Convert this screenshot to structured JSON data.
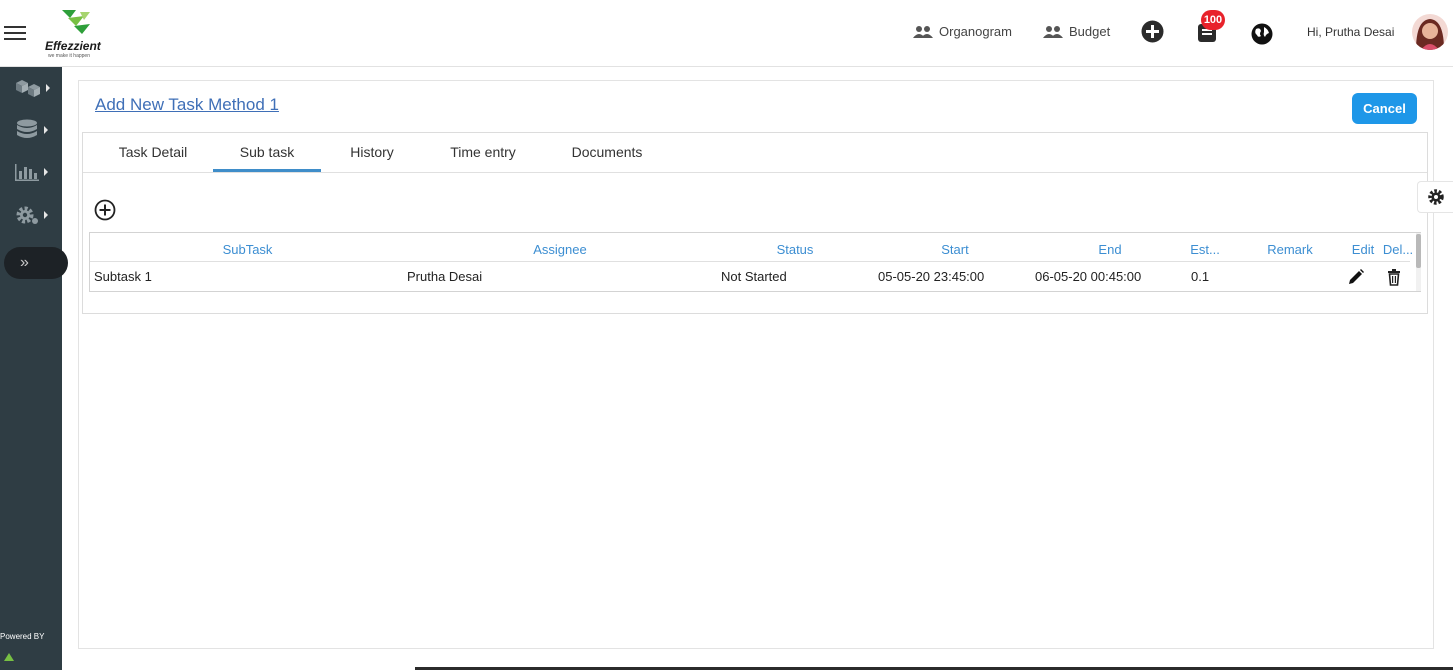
{
  "header": {
    "logo_name": "Effezzient",
    "logo_tagline": "we make it happen",
    "links": [
      {
        "label": "Organogram",
        "icon": "people-icon"
      },
      {
        "label": "Budget",
        "icon": "people-icon"
      }
    ],
    "notification_count": "100",
    "greeting": "Hi, Prutha Desai"
  },
  "sidebar": {
    "items": [
      {
        "icon": "boxes-icon"
      },
      {
        "icon": "database-icon"
      },
      {
        "icon": "bar-chart-icon"
      },
      {
        "icon": "gear-icon"
      }
    ],
    "expand_glyph": "»",
    "powered_by": "Powered BY"
  },
  "page": {
    "title": "Add New Task Method 1",
    "cancel_label": "Cancel"
  },
  "tabs": [
    {
      "label": "Task Detail"
    },
    {
      "label": "Sub task",
      "active": true
    },
    {
      "label": "History"
    },
    {
      "label": "Time entry"
    },
    {
      "label": "Documents"
    }
  ],
  "grid": {
    "columns": [
      "SubTask",
      "Assignee",
      "Status",
      "Start",
      "End",
      "Est...",
      "Remark",
      "Edit",
      "Del..."
    ],
    "rows": [
      {
        "subtask": "Subtask 1",
        "assignee": "Prutha Desai",
        "status": "Not Started",
        "start": "05-05-20 23:45:00",
        "end": "06-05-20 00:45:00",
        "est": "0.1",
        "remark": ""
      }
    ]
  },
  "colors": {
    "accent": "#1e97e8",
    "link": "#3f6fb7",
    "header_text": "#3c8ed2",
    "sidebar_bg": "#2f3d44",
    "badge": "#e8222b"
  }
}
